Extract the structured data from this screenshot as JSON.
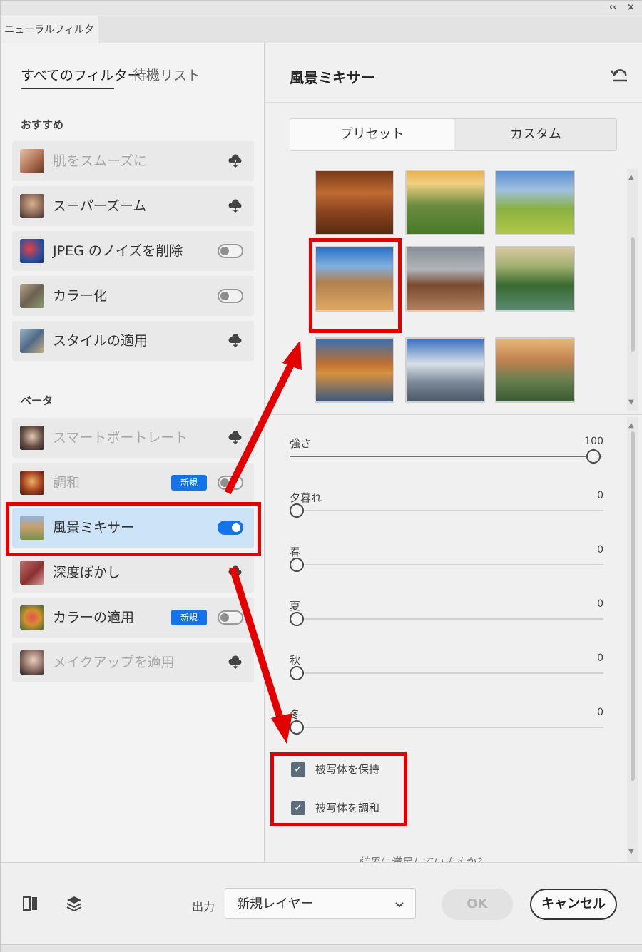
{
  "window": {
    "collapse_glyph": "‹‹",
    "close_glyph": "×",
    "panel_tab": "ニューラルフィルター"
  },
  "left": {
    "tabs": [
      {
        "label": "すべてのフィルター",
        "active": true
      },
      {
        "label": "待機リスト",
        "active": false
      }
    ],
    "recommended_label": "おすすめ",
    "beta_label": "ベータ",
    "recommended": [
      {
        "label": "肌をスムーズに",
        "control": "cloud",
        "dim": true
      },
      {
        "label": "スーパーズーム",
        "control": "cloud",
        "dim": false
      },
      {
        "label": "JPEG のノイズを削除",
        "control": "toggle-off",
        "dim": false
      },
      {
        "label": "カラー化",
        "control": "toggle-off",
        "dim": false
      },
      {
        "label": "スタイルの適用",
        "control": "cloud",
        "dim": false
      }
    ],
    "beta": [
      {
        "label": "スマートポートレート",
        "control": "cloud",
        "dim": true
      },
      {
        "label": "調和",
        "control": "toggle-off",
        "dim": true,
        "badge": "新規"
      },
      {
        "label": "風景ミキサー",
        "control": "toggle-on",
        "dim": false,
        "selected": true
      },
      {
        "label": "深度ぼかし",
        "control": "cloud",
        "dim": false
      },
      {
        "label": "カラーの適用",
        "control": "toggle-off",
        "dim": false,
        "badge": "新規"
      },
      {
        "label": "メイクアップを適用",
        "control": "cloud",
        "dim": true
      }
    ]
  },
  "right": {
    "title": "風景ミキサー",
    "segments": [
      {
        "label": "プリセット",
        "active": true
      },
      {
        "label": "カスタム",
        "active": false
      }
    ],
    "sliders": [
      {
        "label": "強さ",
        "value": 100,
        "max": 100
      },
      {
        "label": "夕暮れ",
        "value": 0,
        "max": 100
      },
      {
        "label": "春",
        "value": 0,
        "max": 100
      },
      {
        "label": "夏",
        "value": 0,
        "max": 100
      },
      {
        "label": "秋",
        "value": 0,
        "max": 100
      },
      {
        "label": "冬",
        "value": 0,
        "max": 100
      }
    ],
    "checkboxes": [
      {
        "label": "被写体を保持",
        "checked": true
      },
      {
        "label": "被写体を調和",
        "checked": true
      }
    ],
    "feedback_partial": "結果に満足していますか？"
  },
  "bottom": {
    "output_label": "出力",
    "output_value": "新規レイヤー",
    "ok_label": "OK",
    "cancel_label": "キャンセル"
  },
  "colors": {
    "accent_blue": "#1473e6",
    "annotation_red": "#e30000",
    "selected_row": "#cde3f8"
  }
}
